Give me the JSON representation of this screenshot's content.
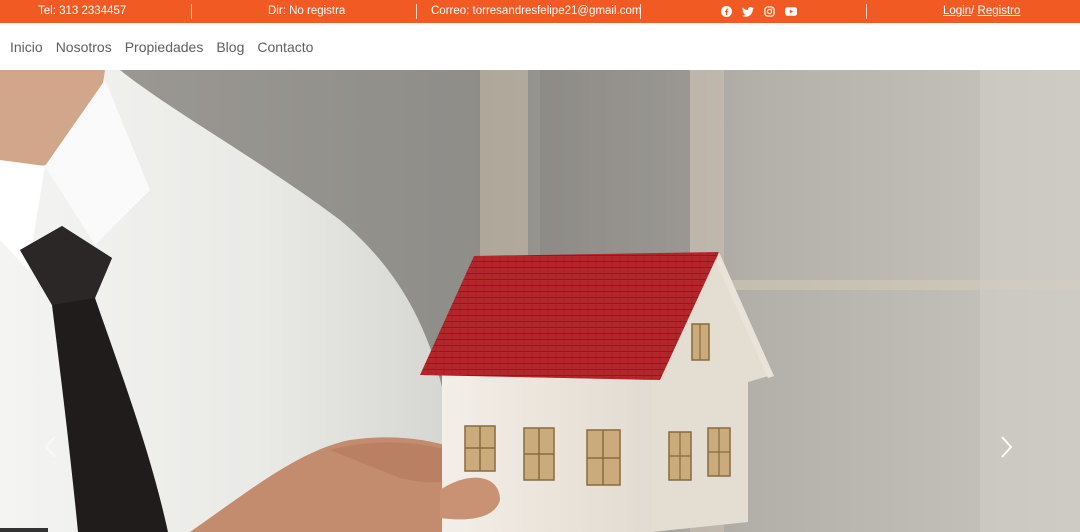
{
  "topbar": {
    "phone": "Tel: 313 2334457",
    "address": "Dir: No registra",
    "email": "Correo: torresandresfelipe21@gmail.com",
    "social_icons": [
      "facebook-icon",
      "twitter-icon",
      "instagram-icon",
      "youtube-icon"
    ],
    "login_label": "Login",
    "divider": "/",
    "register_label": "Registro",
    "accent_color": "#f15a22"
  },
  "nav": {
    "items": [
      "Inicio",
      "Nosotros",
      "Propiedades",
      "Blog",
      "Contacto"
    ]
  },
  "carousel": {
    "prev_icon": "chevron-left-icon",
    "next_icon": "chevron-right-icon"
  }
}
